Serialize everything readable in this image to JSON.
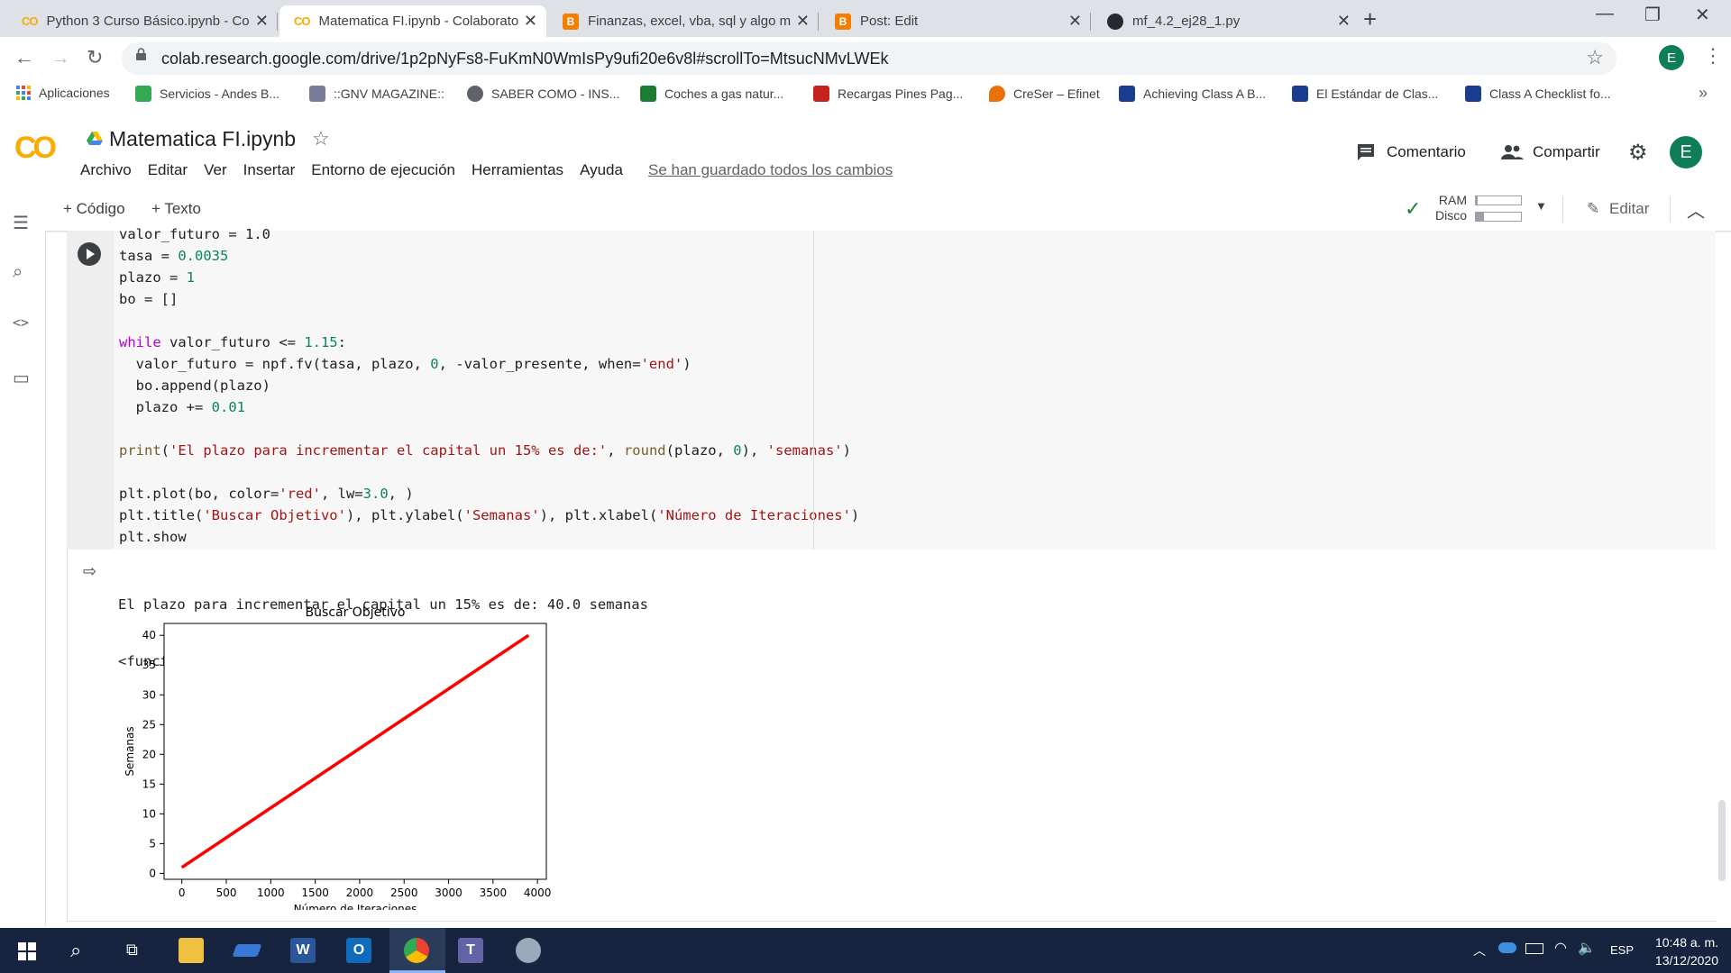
{
  "browser": {
    "tabs": [
      {
        "title": "Python 3 Curso Básico.ipynb - Co",
        "favicon": "colab-icon",
        "active": false
      },
      {
        "title": "Matematica FI.ipynb - Colaborato",
        "favicon": "colab-icon",
        "active": true
      },
      {
        "title": "Finanzas, excel, vba, sql y algo m",
        "favicon": "blogger-icon",
        "active": false
      },
      {
        "title": "Post: Edit",
        "favicon": "blogger-icon",
        "active": false
      },
      {
        "title": "mf_4.2_ej28_1.py",
        "favicon": "github-icon",
        "active": false
      }
    ],
    "url": "colab.research.google.com/drive/1p2pNyFs8-FuKmN0WmIsPy9ufi20e6v8l#scrollTo=MtsucNMvLWEk",
    "profile_initial": "E",
    "bookmarks": [
      {
        "label": "Aplicaciones",
        "color": "#4285f4"
      },
      {
        "label": "Servicios - Andes B...",
        "color": "#34a853"
      },
      {
        "label": "::GNV MAGAZINE::",
        "color": "#7b7b9c"
      },
      {
        "label": "SABER COMO - INS...",
        "color": "#5f6368"
      },
      {
        "label": "Coches a gas natur...",
        "color": "#1e7b34"
      },
      {
        "label": "Recargas Pines Pag...",
        "color": "#c5221f"
      },
      {
        "label": "CreSer – Efinet",
        "color": "#e8710a"
      },
      {
        "label": "Achieving Class A B...",
        "color": "#1a3d8f"
      },
      {
        "label": "El Estándar de Clas...",
        "color": "#1a3d8f"
      },
      {
        "label": "Class A Checklist fo...",
        "color": "#1a3d8f"
      }
    ],
    "bookmarks_more": "»"
  },
  "colab": {
    "notebook_name": "Matematica FI.ipynb",
    "menus": [
      "Archivo",
      "Editar",
      "Ver",
      "Insertar",
      "Entorno de ejecución",
      "Herramientas",
      "Ayuda"
    ],
    "save_status": "Se han guardado todos los cambios",
    "comment_label": "Comentario",
    "share_label": "Compartir",
    "avatar_initial": "E",
    "add_code_label": "+ Código",
    "add_text_label": "+ Texto",
    "ram_label": "RAM",
    "disk_label": "Disco",
    "ram_usage": 0.04,
    "disk_usage": 0.18,
    "edit_label": "Editar"
  },
  "cell": {
    "code_lines": [
      [
        {
          "t": "valor_futuro = 1.0"
        }
      ],
      [
        {
          "t": "tasa = "
        },
        {
          "t": "0.0035",
          "c": "num"
        }
      ],
      [
        {
          "t": "plazo = "
        },
        {
          "t": "1",
          "c": "num"
        }
      ],
      [
        {
          "t": "bo = []"
        }
      ],
      [
        {
          "t": ""
        }
      ],
      [
        {
          "t": "while",
          "c": "kw"
        },
        {
          "t": " valor_futuro <= "
        },
        {
          "t": "1.15",
          "c": "num"
        },
        {
          "t": ":"
        }
      ],
      [
        {
          "t": "  valor_futuro = npf.fv(tasa, plazo, "
        },
        {
          "t": "0",
          "c": "num"
        },
        {
          "t": ", -valor_presente, when="
        },
        {
          "t": "'end'",
          "c": "str"
        },
        {
          "t": ")"
        }
      ],
      [
        {
          "t": "  bo.append(plazo)"
        }
      ],
      [
        {
          "t": "  plazo += "
        },
        {
          "t": "0.01",
          "c": "num"
        }
      ],
      [
        {
          "t": ""
        }
      ],
      [
        {
          "t": "print",
          "c": "fn"
        },
        {
          "t": "("
        },
        {
          "t": "'El plazo para incrementar el capital un 15% es de:'",
          "c": "str"
        },
        {
          "t": ", "
        },
        {
          "t": "round",
          "c": "fn"
        },
        {
          "t": "(plazo, "
        },
        {
          "t": "0",
          "c": "num"
        },
        {
          "t": "), "
        },
        {
          "t": "'semanas'",
          "c": "str"
        },
        {
          "t": ")"
        }
      ],
      [
        {
          "t": ""
        }
      ],
      [
        {
          "t": "plt.plot(bo, color="
        },
        {
          "t": "'red'",
          "c": "str"
        },
        {
          "t": ", lw="
        },
        {
          "t": "3.0",
          "c": "num"
        },
        {
          "t": ", )"
        }
      ],
      [
        {
          "t": "plt.title("
        },
        {
          "t": "'Buscar Objetivo'",
          "c": "str"
        },
        {
          "t": "), plt.ylabel("
        },
        {
          "t": "'Semanas'",
          "c": "str"
        },
        {
          "t": "), plt.xlabel("
        },
        {
          "t": "'Número de Iteraciones'",
          "c": "str"
        },
        {
          "t": ")"
        }
      ],
      [
        {
          "t": "plt.show"
        }
      ]
    ],
    "output_lines": [
      "El plazo para incrementar el capital un 15% es de: 40.0 semanas",
      "<function matplotlib.pyplot.show>"
    ]
  },
  "chart_data": {
    "type": "line",
    "title": "Buscar Objetivo",
    "xlabel": "Número de Iteraciones",
    "ylabel": "Semanas",
    "xlim": [
      -200,
      4100
    ],
    "ylim": [
      -1,
      42
    ],
    "xticks": [
      0,
      500,
      1000,
      1500,
      2000,
      2500,
      3000,
      3500,
      4000
    ],
    "yticks": [
      0,
      5,
      10,
      15,
      20,
      25,
      30,
      35,
      40
    ],
    "series": [
      {
        "color": "#ff0000",
        "x": [
          0,
          3900
        ],
        "y": [
          1,
          40
        ]
      }
    ]
  },
  "taskbar": {
    "apps": [
      "windows-start",
      "search",
      "task-view",
      "file-explorer",
      "pen-app",
      "word",
      "outlook",
      "chrome",
      "teams",
      "paint"
    ],
    "language": "ESP",
    "time": "10:48 a. m.",
    "date": "13/12/2020"
  }
}
